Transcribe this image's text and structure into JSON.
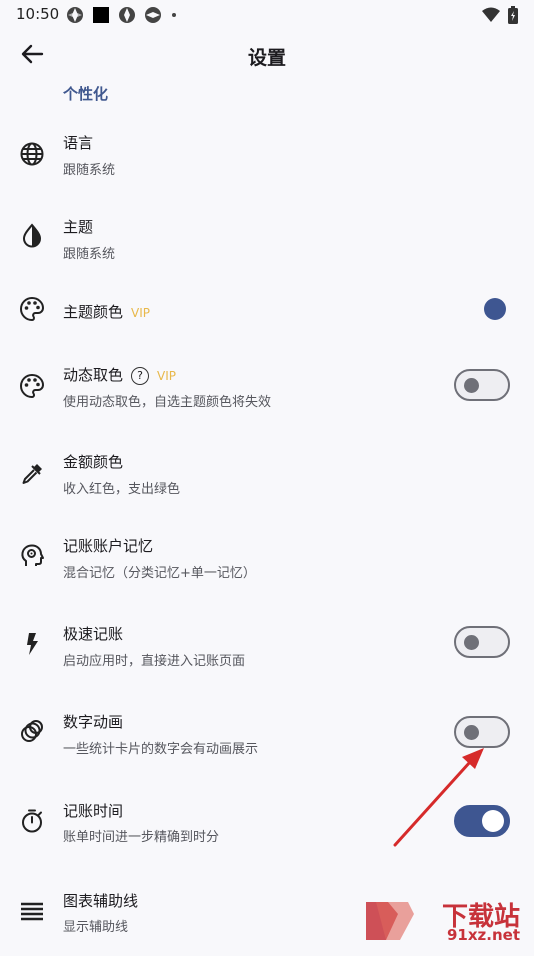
{
  "status_bar": {
    "time": "10:50"
  },
  "app_bar": {
    "title": "设置"
  },
  "section_title": "个性化",
  "vip_label": "VIP",
  "items": [
    {
      "label": "语言",
      "subtitle": "跟随系统"
    },
    {
      "label": "主题",
      "subtitle": "跟随系统"
    },
    {
      "label": "主题颜色",
      "subtitle": ""
    },
    {
      "label": "动态取色",
      "subtitle": "使用动态取色，自选主题颜色将失效",
      "help": "?"
    },
    {
      "label": "金额颜色",
      "subtitle": "收入红色，支出绿色"
    },
    {
      "label": "记账账户记忆",
      "subtitle": "混合记忆（分类记忆+单一记忆）"
    },
    {
      "label": "极速记账",
      "subtitle": "启动应用时，直接进入记账页面"
    },
    {
      "label": "数字动画",
      "subtitle": "一些统计卡片的数字会有动画展示"
    },
    {
      "label": "记账时间",
      "subtitle": "账单时间进一步精确到时分"
    },
    {
      "label": "图表辅助线",
      "subtitle": "显示辅助线"
    }
  ],
  "toggles": {
    "dynamic_color": false,
    "quick_record": false,
    "number_animation": false,
    "record_time": true
  },
  "colors": {
    "accent": "#3e5691",
    "section": "#40588f",
    "vip": "#e8b84a"
  },
  "watermark": {
    "main": "下载站",
    "site": "91xz.net"
  }
}
